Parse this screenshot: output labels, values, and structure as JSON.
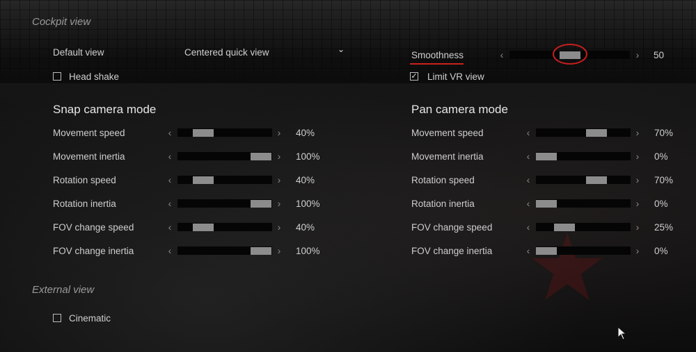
{
  "cockpit": {
    "title": "Cockpit view",
    "default_view_label": "Default view",
    "default_view_value": "Centered quick view",
    "head_shake_label": "Head shake",
    "head_shake_checked": false,
    "smoothness": {
      "label": "Smoothness",
      "value": "50",
      "level": 0.5
    },
    "limit_vr_label": "Limit VR view",
    "limit_vr_checked": true,
    "check_glyph": "✓"
  },
  "arrows": {
    "left": "‹",
    "right": "›",
    "chevron": "⌄"
  },
  "snap": {
    "title": "Snap camera mode",
    "rows": [
      {
        "label": "Movement speed",
        "value": "40%",
        "level": 0.4
      },
      {
        "label": "Movement inertia",
        "value": "100%",
        "level": 1.0
      },
      {
        "label": "Rotation speed",
        "value": "40%",
        "level": 0.4
      },
      {
        "label": "Rotation inertia",
        "value": "100%",
        "level": 1.0
      },
      {
        "label": "FOV change speed",
        "value": "40%",
        "level": 0.4
      },
      {
        "label": "FOV change inertia",
        "value": "100%",
        "level": 1.0
      }
    ]
  },
  "pan": {
    "title": "Pan camera mode",
    "rows": [
      {
        "label": "Movement speed",
        "value": "70%",
        "level": 0.7
      },
      {
        "label": "Movement inertia",
        "value": "0%",
        "level": 0.0
      },
      {
        "label": "Rotation speed",
        "value": "70%",
        "level": 0.7
      },
      {
        "label": "Rotation inertia",
        "value": "0%",
        "level": 0.0
      },
      {
        "label": "FOV change speed",
        "value": "25%",
        "level": 0.25
      },
      {
        "label": "FOV change inertia",
        "value": "0%",
        "level": 0.0
      }
    ]
  },
  "external": {
    "title": "External view",
    "cinematic_label": "Cinematic",
    "cinematic_checked": false
  },
  "colors": {
    "accent_red": "#c8221e",
    "thumb": "#8c8c8c",
    "track": "#050505"
  }
}
